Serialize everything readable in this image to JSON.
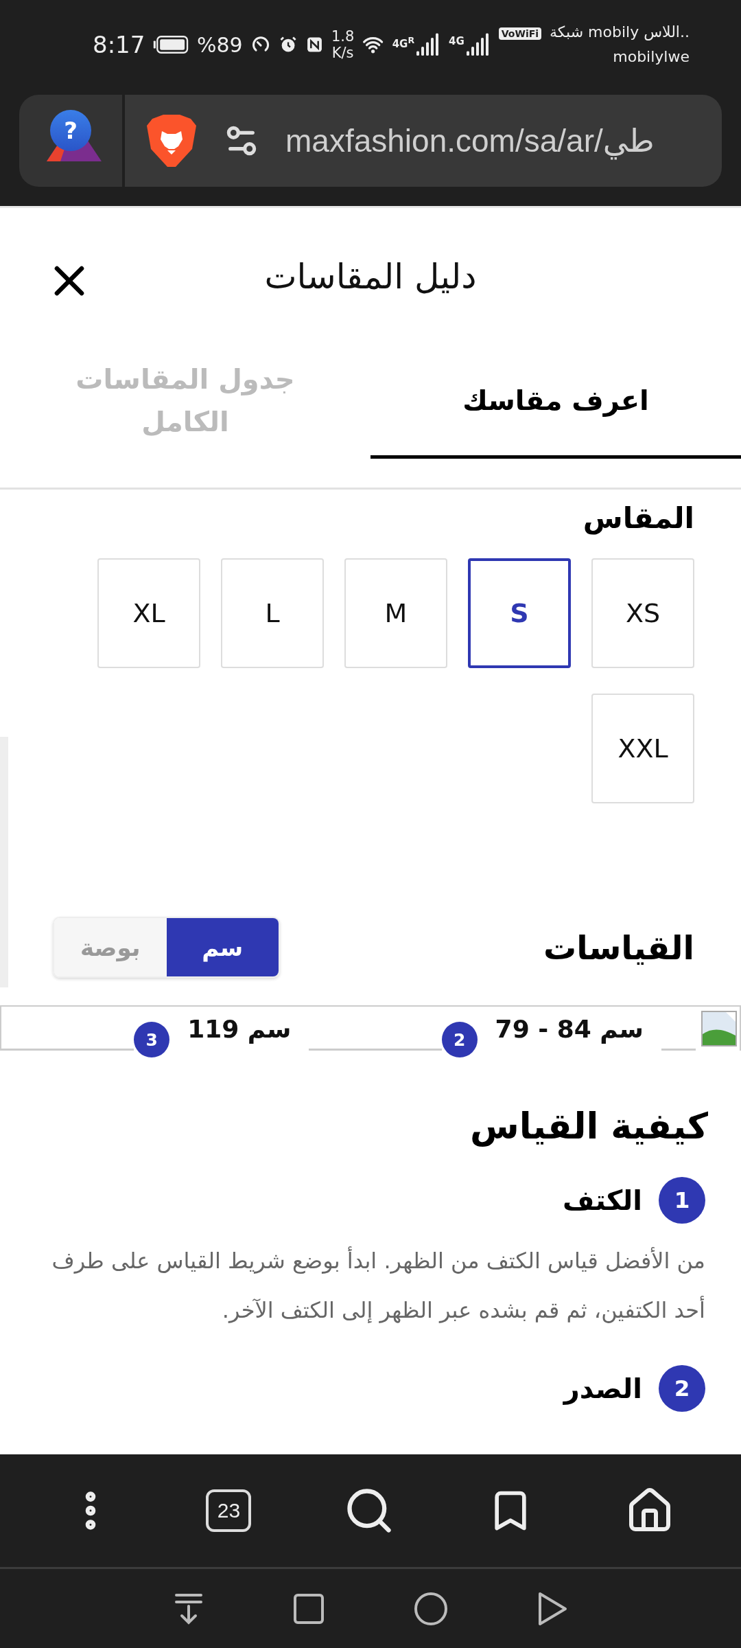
{
  "status_bar": {
    "time": "8:17",
    "battery": "%89",
    "speed": [
      "1.8",
      "K/s"
    ],
    "signals": [
      {
        "label": "4G"
      },
      {
        "label": "4G",
        "flag": "R"
      }
    ],
    "vowifi": "VoWiFi",
    "carrier": [
      "شبكة mobily اللاس..",
      "mobilylwe"
    ]
  },
  "address_bar": {
    "rewards_badge": "?",
    "url": "maxfashion.com/sa/ar/طي"
  },
  "dialog": {
    "title": "دليل المقاسات",
    "tabs": [
      {
        "label": "اعرف مقاسك",
        "selected": true
      },
      {
        "label": "جدول المقاسات الكامل",
        "selected": false
      }
    ]
  },
  "size_section": {
    "heading": "المقاس",
    "sizes": [
      {
        "label": "XS",
        "selected": false
      },
      {
        "label": "S",
        "selected": true
      },
      {
        "label": "M",
        "selected": false
      },
      {
        "label": "L",
        "selected": false
      },
      {
        "label": "XL",
        "selected": false
      },
      {
        "label": "XXL",
        "selected": false
      }
    ]
  },
  "measurements": {
    "heading": "القياسات",
    "units": [
      {
        "label": "سم",
        "selected": true
      },
      {
        "label": "بوصة",
        "selected": false
      }
    ],
    "points": [
      {
        "number": "2",
        "value": "سم 84 - 79"
      },
      {
        "number": "3",
        "value": "سم 119"
      }
    ]
  },
  "how_to_measure": {
    "heading": "كيفية القياس",
    "steps": [
      {
        "number": "1",
        "title": "الكتف",
        "text": "من الأفضل قياس الكتف من الظهر. ابدأ بوضع شريط القياس على طرف أحد الكتفين، ثم قم بشده عبر الظهر إلى الكتف الآخر."
      },
      {
        "number": "2",
        "title": "الصدر"
      }
    ]
  },
  "toolbar": {
    "tab_count": "23"
  }
}
